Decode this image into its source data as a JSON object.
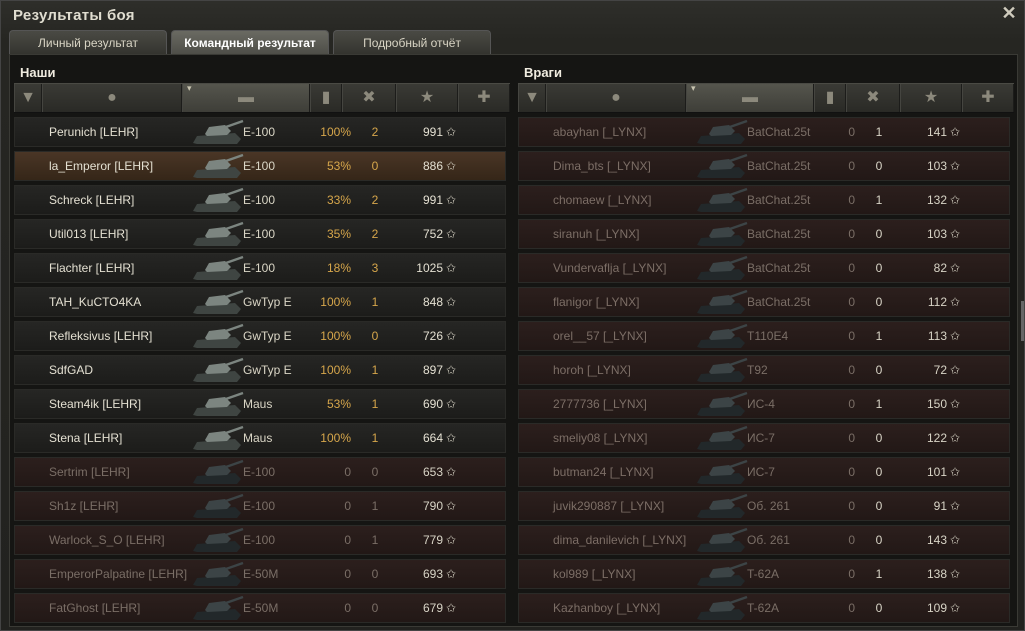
{
  "window": {
    "title": "Результаты боя"
  },
  "tabs": [
    "Личный результат",
    "Командный результат",
    "Подробный отчёт"
  ],
  "active_tab": 1,
  "colors": {
    "accent": "#d6a64b",
    "dead_row": "#2c1f1d",
    "self_row": "#4a3626"
  },
  "header_icons": [
    "platoon-icon",
    "player-icon",
    "tank-icon",
    "damage-icon",
    "kills-icon",
    "xp-star-icon",
    "medal-icon"
  ],
  "allies": {
    "name": "Наши",
    "rows": [
      {
        "player": "Perunich [LEHR]",
        "tank": "E-100",
        "damage": "100%",
        "kills": "2",
        "xp": "991",
        "state": "alive"
      },
      {
        "player": "la_Emperor [LEHR]",
        "tank": "E-100",
        "damage": "53%",
        "kills": "0",
        "xp": "886",
        "state": "me"
      },
      {
        "player": "Schreck [LEHR]",
        "tank": "E-100",
        "damage": "33%",
        "kills": "2",
        "xp": "991",
        "state": "alive"
      },
      {
        "player": "Util013 [LEHR]",
        "tank": "E-100",
        "damage": "35%",
        "kills": "2",
        "xp": "752",
        "state": "alive"
      },
      {
        "player": "Flachter [LEHR]",
        "tank": "E-100",
        "damage": "18%",
        "kills": "3",
        "xp": "1025",
        "state": "alive"
      },
      {
        "player": "TAH_KuCTO4KA",
        "tank": "GwTyp E",
        "damage": "100%",
        "kills": "1",
        "xp": "848",
        "state": "alive"
      },
      {
        "player": "Refleksivus [LEHR]",
        "tank": "GwTyp E",
        "damage": "100%",
        "kills": "0",
        "xp": "726",
        "state": "alive"
      },
      {
        "player": "SdfGAD",
        "tank": "GwTyp E",
        "damage": "100%",
        "kills": "1",
        "xp": "897",
        "state": "alive"
      },
      {
        "player": "Steam4ik [LEHR]",
        "tank": "Maus",
        "damage": "53%",
        "kills": "1",
        "xp": "690",
        "state": "alive"
      },
      {
        "player": "Stena [LEHR]",
        "tank": "Maus",
        "damage": "100%",
        "kills": "1",
        "xp": "664",
        "state": "alive"
      },
      {
        "player": "Sertrim [LEHR]",
        "tank": "E-100",
        "damage": "0",
        "kills": "0",
        "xp": "653",
        "state": "dead"
      },
      {
        "player": "Sh1z [LEHR]",
        "tank": "E-100",
        "damage": "0",
        "kills": "1",
        "xp": "790",
        "state": "dead"
      },
      {
        "player": "Warlock_S_O [LEHR]",
        "tank": "E-100",
        "damage": "0",
        "kills": "1",
        "xp": "779",
        "state": "dead"
      },
      {
        "player": "EmperorPalpatine [LEHR]",
        "tank": "E-50M",
        "damage": "0",
        "kills": "0",
        "xp": "693",
        "state": "dead"
      },
      {
        "player": "FatGhost [LEHR]",
        "tank": "E-50M",
        "damage": "0",
        "kills": "0",
        "xp": "679",
        "state": "dead"
      }
    ]
  },
  "enemies": {
    "name": "Враги",
    "rows": [
      {
        "player": "abayhan [_LYNX]",
        "tank": "BatChat.25t",
        "damage": "0",
        "kills": "1",
        "xp": "141",
        "state": "dead"
      },
      {
        "player": "Dima_bts [_LYNX]",
        "tank": "BatChat.25t",
        "damage": "0",
        "kills": "0",
        "xp": "103",
        "state": "dead"
      },
      {
        "player": "chomaew [_LYNX]",
        "tank": "BatChat.25t",
        "damage": "0",
        "kills": "1",
        "xp": "132",
        "state": "dead"
      },
      {
        "player": "siranuh [_LYNX]",
        "tank": "BatChat.25t",
        "damage": "0",
        "kills": "0",
        "xp": "103",
        "state": "dead"
      },
      {
        "player": "Vundervaflja [_LYNX]",
        "tank": "BatChat.25t",
        "damage": "0",
        "kills": "0",
        "xp": "82",
        "state": "dead"
      },
      {
        "player": "flanigor [_LYNX]",
        "tank": "BatChat.25t",
        "damage": "0",
        "kills": "0",
        "xp": "112",
        "state": "dead"
      },
      {
        "player": "orel__57 [_LYNX]",
        "tank": "T110E4",
        "damage": "0",
        "kills": "1",
        "xp": "113",
        "state": "dead"
      },
      {
        "player": "horoh [_LYNX]",
        "tank": "T92",
        "damage": "0",
        "kills": "0",
        "xp": "72",
        "state": "dead"
      },
      {
        "player": "2777736 [_LYNX]",
        "tank": "ИС-4",
        "damage": "0",
        "kills": "1",
        "xp": "150",
        "state": "dead"
      },
      {
        "player": "smeliy08 [_LYNX]",
        "tank": "ИС-7",
        "damage": "0",
        "kills": "0",
        "xp": "122",
        "state": "dead"
      },
      {
        "player": "butman24 [_LYNX]",
        "tank": "ИС-7",
        "damage": "0",
        "kills": "0",
        "xp": "101",
        "state": "dead"
      },
      {
        "player": "juvik290887 [_LYNX]",
        "tank": "Об. 261",
        "damage": "0",
        "kills": "0",
        "xp": "91",
        "state": "dead"
      },
      {
        "player": "dima_danilevich [_LYNX]",
        "tank": "Об. 261",
        "damage": "0",
        "kills": "0",
        "xp": "143",
        "state": "dead"
      },
      {
        "player": "kol989 [_LYNX]",
        "tank": "T-62A",
        "damage": "0",
        "kills": "1",
        "xp": "138",
        "state": "dead"
      },
      {
        "player": "Kazhanboy [_LYNX]",
        "tank": "T-62A",
        "damage": "0",
        "kills": "0",
        "xp": "109",
        "state": "dead"
      }
    ]
  }
}
